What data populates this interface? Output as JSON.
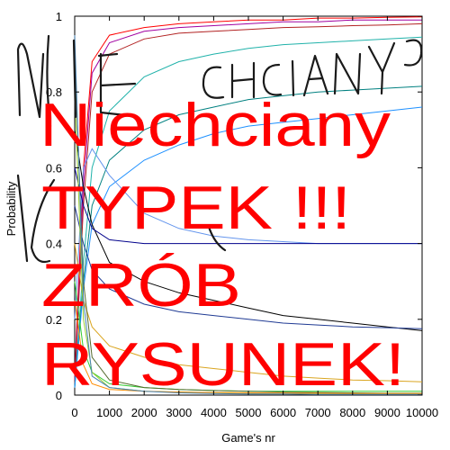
{
  "chart_data": {
    "type": "line",
    "xlabel": "Game's nr",
    "ylabel": "Probability",
    "xlim": [
      0,
      10000
    ],
    "ylim": [
      0,
      1
    ],
    "x_ticks": [
      "0",
      "1000",
      "2000",
      "3000",
      "4000",
      "5000",
      "6000",
      "7000",
      "8000",
      "9000",
      "10000"
    ],
    "y_ticks": [
      "0",
      "0.2",
      "0.4",
      "0.6",
      "0.8",
      "1"
    ],
    "x": [
      0,
      250,
      500,
      1000,
      2000,
      3000,
      4000,
      5000,
      6000,
      7000,
      8000,
      9000,
      10000
    ],
    "series": [
      {
        "color": "#ff0000",
        "values": [
          0.05,
          0.6,
          0.88,
          0.95,
          0.97,
          0.98,
          0.985,
          0.99,
          0.99,
          0.995,
          0.995,
          0.997,
          0.998
        ]
      },
      {
        "color": "#a000a0",
        "values": [
          0.04,
          0.55,
          0.85,
          0.93,
          0.96,
          0.97,
          0.975,
          0.98,
          0.985,
          0.985,
          0.99,
          0.99,
          0.99
        ]
      },
      {
        "color": "#b22222",
        "values": [
          0.03,
          0.5,
          0.8,
          0.9,
          0.94,
          0.955,
          0.96,
          0.965,
          0.97,
          0.972,
          0.975,
          0.977,
          0.98
        ]
      },
      {
        "color": "#20b2aa",
        "values": [
          0.02,
          0.35,
          0.6,
          0.75,
          0.84,
          0.88,
          0.9,
          0.915,
          0.925,
          0.93,
          0.935,
          0.94,
          0.945
        ]
      },
      {
        "color": "#008080",
        "values": [
          0.02,
          0.3,
          0.5,
          0.62,
          0.7,
          0.74,
          0.76,
          0.78,
          0.79,
          0.8,
          0.805,
          0.81,
          0.815
        ]
      },
      {
        "color": "#1e90ff",
        "values": [
          0.02,
          0.28,
          0.45,
          0.55,
          0.62,
          0.66,
          0.69,
          0.71,
          0.72,
          0.73,
          0.74,
          0.75,
          0.76
        ]
      },
      {
        "color": "#6495ed",
        "values": [
          0.2,
          0.6,
          0.65,
          0.58,
          0.48,
          0.44,
          0.42,
          0.41,
          0.405,
          0.4,
          0.4,
          0.4,
          0.4
        ]
      },
      {
        "color": "#000000",
        "values": [
          0.7,
          0.55,
          0.45,
          0.35,
          0.3,
          0.27,
          0.25,
          0.23,
          0.21,
          0.2,
          0.19,
          0.18,
          0.17
        ]
      },
      {
        "color": "#00008b",
        "values": [
          0.6,
          0.5,
          0.44,
          0.41,
          0.4,
          0.4,
          0.4,
          0.4,
          0.4,
          0.4,
          0.4,
          0.4,
          0.4
        ]
      },
      {
        "color": "#1f3a93",
        "values": [
          0.5,
          0.4,
          0.33,
          0.28,
          0.24,
          0.22,
          0.21,
          0.2,
          0.19,
          0.185,
          0.18,
          0.178,
          0.175
        ]
      },
      {
        "color": "#daa520",
        "values": [
          0.4,
          0.25,
          0.18,
          0.13,
          0.1,
          0.08,
          0.07,
          0.06,
          0.05,
          0.045,
          0.04,
          0.038,
          0.035
        ]
      },
      {
        "color": "#32cd32",
        "values": [
          0.3,
          0.12,
          0.06,
          0.03,
          0.02,
          0.015,
          0.012,
          0.01,
          0.01,
          0.01,
          0.01,
          0.01,
          0.01
        ]
      },
      {
        "color": "#556b2f",
        "values": [
          0.9,
          0.3,
          0.1,
          0.04,
          0.02,
          0.015,
          0.012,
          0.01,
          0.008,
          0.007,
          0.006,
          0.005,
          0.005
        ]
      },
      {
        "color": "#9acd32",
        "values": [
          0.8,
          0.2,
          0.06,
          0.02,
          0.01,
          0.008,
          0.006,
          0.005,
          0.005,
          0.004,
          0.004,
          0.004,
          0.004
        ]
      },
      {
        "color": "#ff8c00",
        "values": [
          0.25,
          0.08,
          0.03,
          0.015,
          0.01,
          0.008,
          0.007,
          0.006,
          0.005,
          0.005,
          0.004,
          0.004,
          0.004
        ]
      },
      {
        "color": "#4682b4",
        "values": [
          0.95,
          0.25,
          0.05,
          0.02,
          0.01,
          0.006,
          0.004,
          0.003,
          0.003,
          0.002,
          0.002,
          0.002,
          0.002
        ]
      }
    ]
  },
  "overlay": {
    "handwritten": "NIE CHCIANY",
    "lines": [
      "Niechciany",
      "TYPEK !!!",
      "ZRÓB",
      "RYSUNEK!"
    ]
  }
}
